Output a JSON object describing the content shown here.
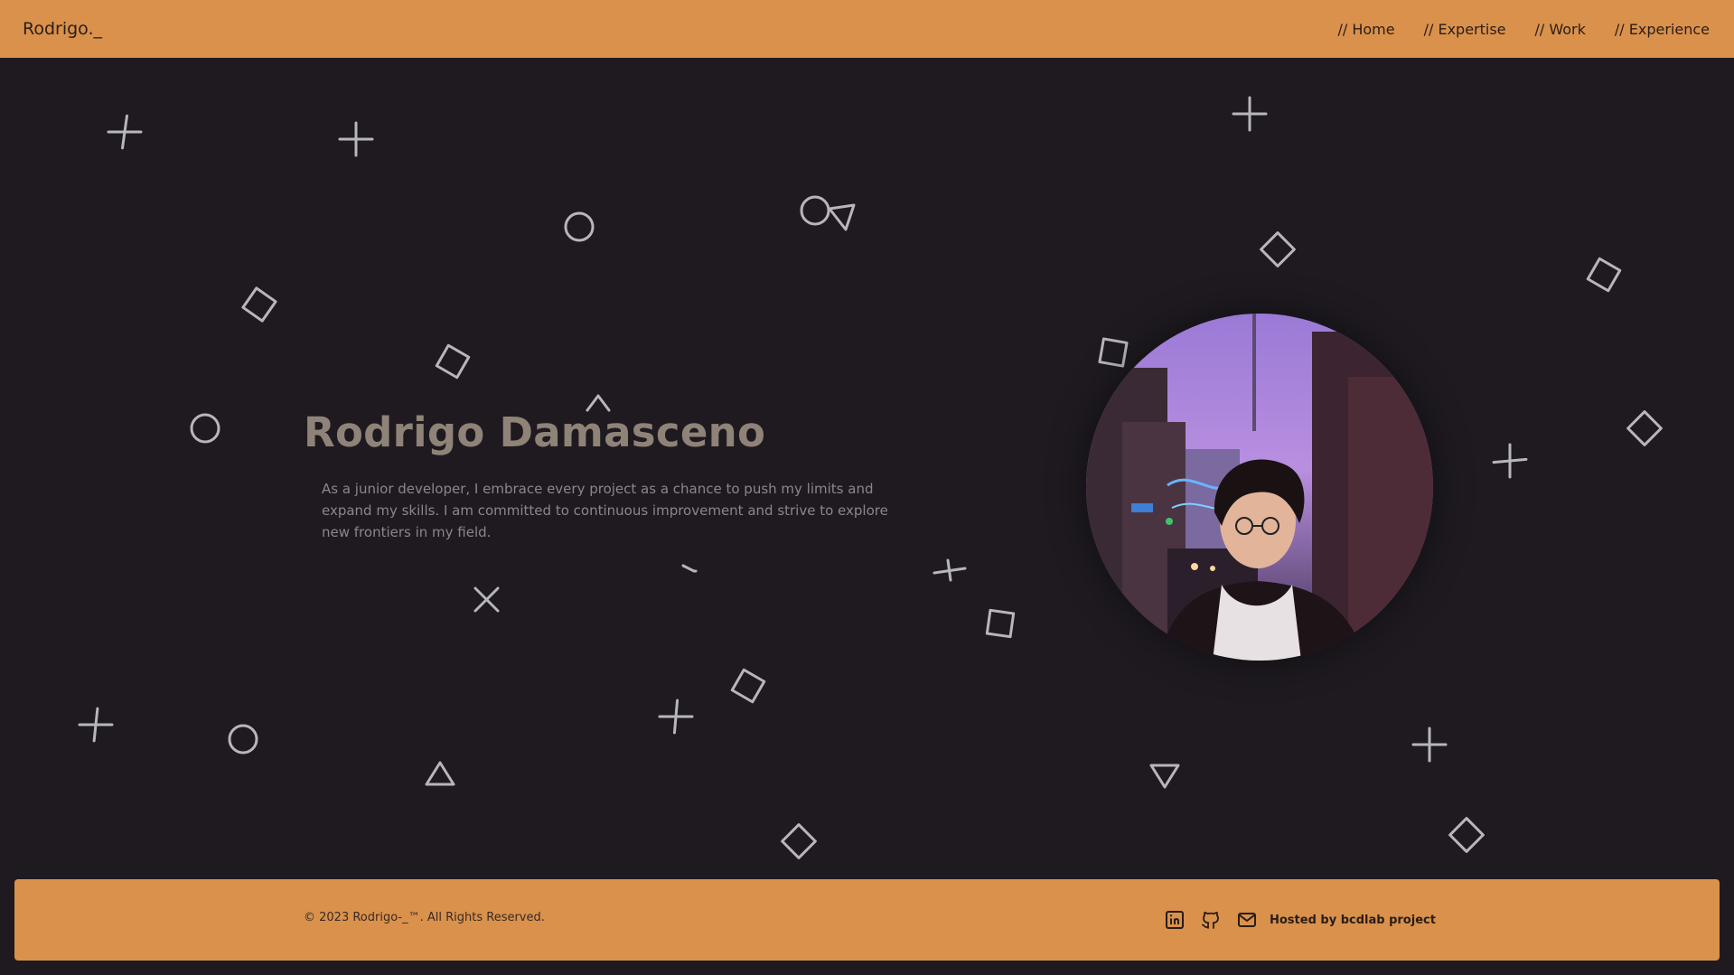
{
  "header": {
    "brand": "Rodrigo._",
    "nav": [
      "// Home",
      "// Expertise",
      "// Work",
      "// Experience"
    ]
  },
  "hero": {
    "title": "Rodrigo Damasceno",
    "description": "As a junior developer, I embrace every project as a chance to push my limits and expand my skills. I am committed to continuous improvement and strive to explore new frontiers in my field.",
    "photo_alt": "portrait"
  },
  "footer": {
    "copyright": "© 2023 Rodrigo-_™. All Rights Reserved.",
    "icons": [
      "linkedin-icon",
      "github-icon",
      "mail-icon"
    ],
    "hosted": "Hosted by bcdlab project"
  },
  "colors": {
    "header_bg": "#d9914c",
    "page_bg": "#1e1a20",
    "title": "#8f8378",
    "shape_stroke": "#b8b5bc"
  }
}
